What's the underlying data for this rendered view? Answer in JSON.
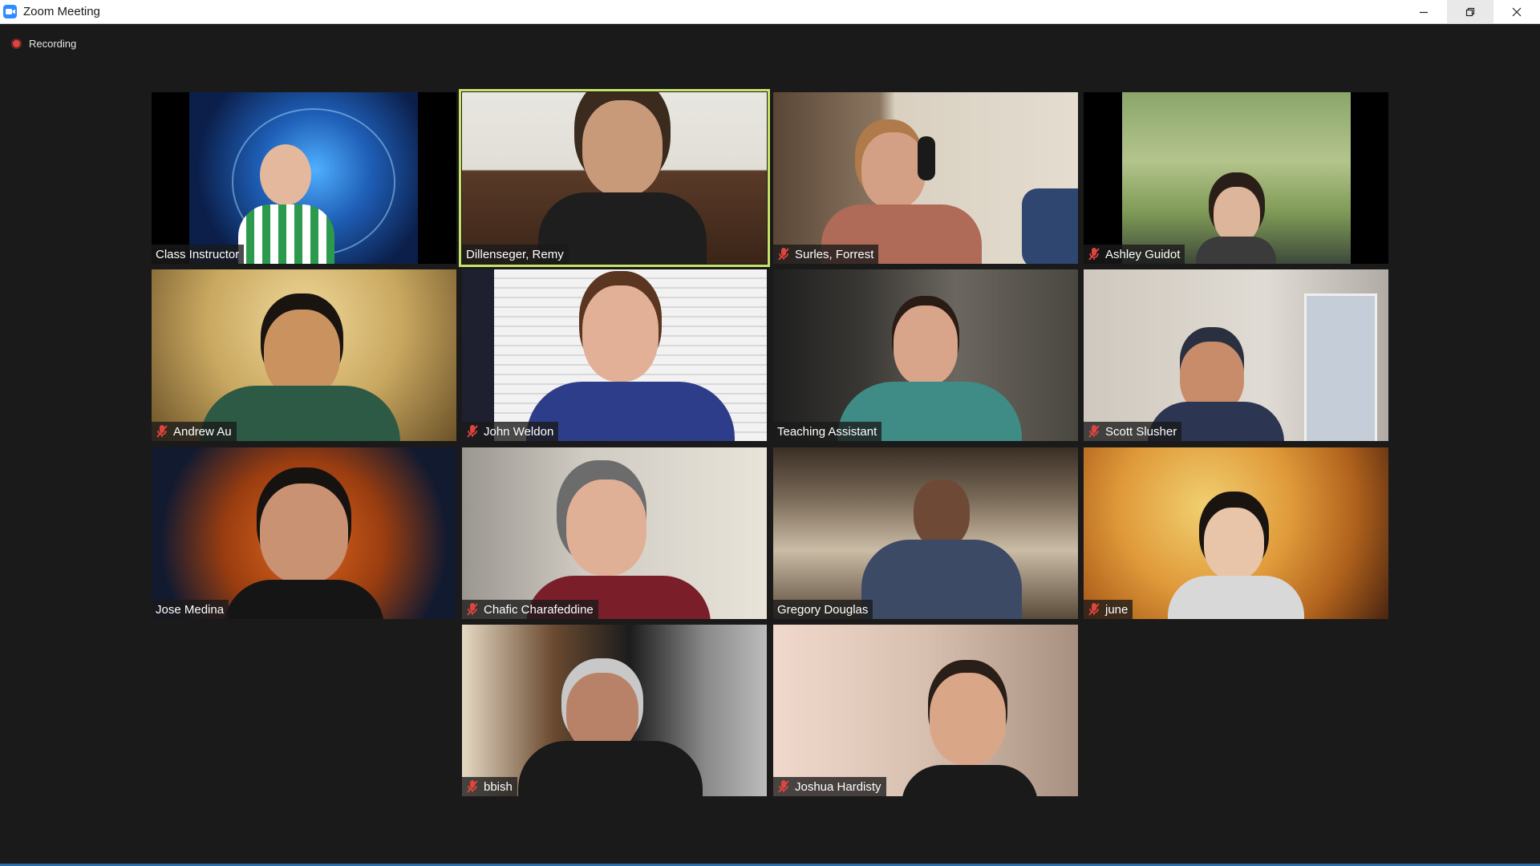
{
  "window": {
    "title": "Zoom Meeting"
  },
  "recording": {
    "label": "Recording"
  },
  "participants": [
    {
      "name": "Class Instructor",
      "muted": false,
      "active": false
    },
    {
      "name": "Dillenseger, Remy",
      "muted": false,
      "active": true
    },
    {
      "name": "Surles, Forrest",
      "muted": true,
      "active": false
    },
    {
      "name": "Ashley Guidot",
      "muted": true,
      "active": false
    },
    {
      "name": "Andrew Au",
      "muted": true,
      "active": false
    },
    {
      "name": "John Weldon",
      "muted": true,
      "active": false
    },
    {
      "name": "Teaching Assistant",
      "muted": false,
      "active": false
    },
    {
      "name": "Scott Slusher",
      "muted": true,
      "active": false
    },
    {
      "name": "Jose Medina",
      "muted": false,
      "active": false
    },
    {
      "name": "Chafic Charafeddine",
      "muted": true,
      "active": false
    },
    {
      "name": "Gregory Douglas",
      "muted": false,
      "active": false
    },
    {
      "name": "june",
      "muted": true,
      "active": false
    },
    {
      "name": "bbish",
      "muted": true,
      "active": false
    },
    {
      "name": "Joshua Hardisty",
      "muted": true,
      "active": false
    }
  ],
  "colors": {
    "active_speaker_border": "#c8e36a",
    "mute_icon": "#e0453d",
    "recording_dot": "#e8413c"
  }
}
